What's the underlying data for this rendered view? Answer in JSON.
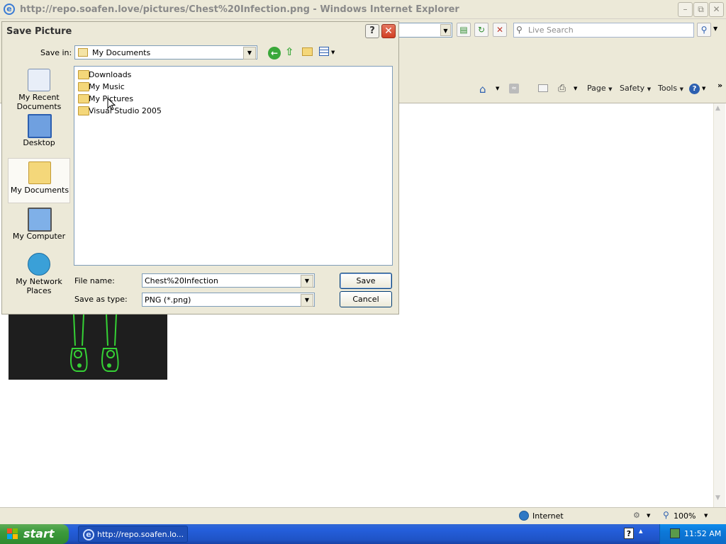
{
  "browser": {
    "title": "http://repo.soafen.love/pictures/Chest%20Infection.png - Windows Internet Explorer",
    "search_placeholder": "Live Search",
    "commands": {
      "page": "Page",
      "safety": "Safety",
      "tools": "Tools"
    },
    "status_zone": "Internet",
    "zoom": "100%"
  },
  "dialog": {
    "title": "Save Picture",
    "save_in_label": "Save in:",
    "save_in_value": "My Documents",
    "places": [
      {
        "label": "My Recent Documents"
      },
      {
        "label": "Desktop"
      },
      {
        "label": "My Documents"
      },
      {
        "label": "My Computer"
      },
      {
        "label": "My Network Places"
      }
    ],
    "files": [
      "Downloads",
      "My Music",
      "My Pictures",
      "Visual Studio 2005"
    ],
    "file_name_label": "File name:",
    "file_name_value": "Chest%20Infection",
    "save_type_label": "Save as type:",
    "save_type_value": "PNG (*.png)",
    "save_button": "Save",
    "cancel_button": "Cancel"
  },
  "taskbar": {
    "start": "start",
    "task_ie": "http://repo.soafen.lo...",
    "clock": "11:52 AM"
  },
  "colors": {
    "taskbar_blue": "#245edb",
    "start_green": "#3c9a3c",
    "dialog_bg": "#ece9d8",
    "close_red": "#d13f22"
  }
}
